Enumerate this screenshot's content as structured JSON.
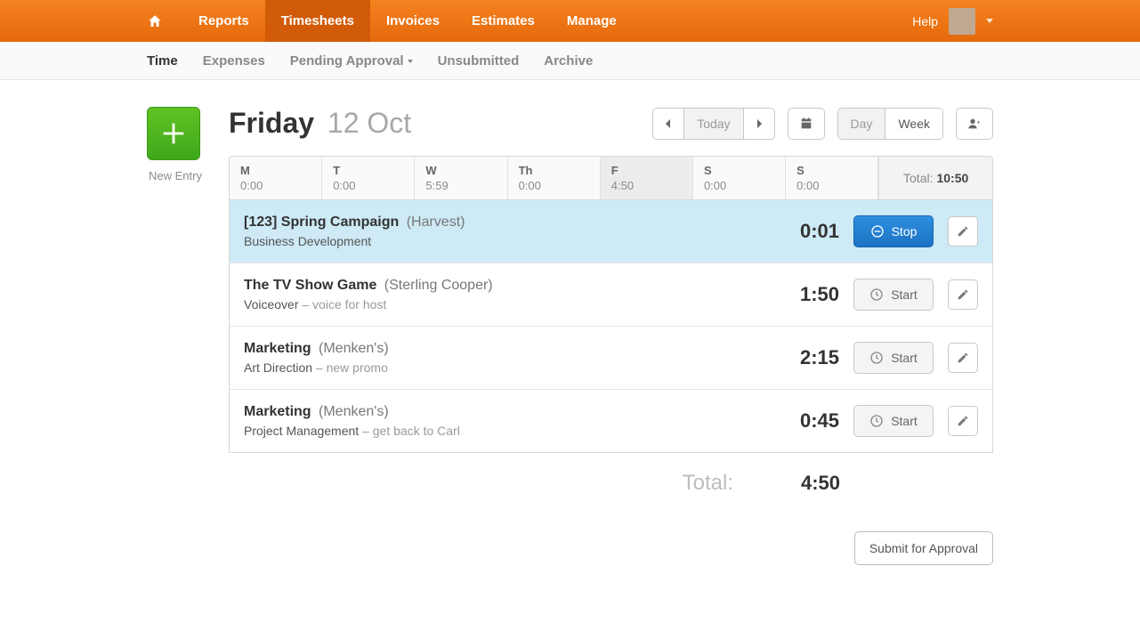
{
  "topnav": {
    "items": [
      {
        "label": "Reports"
      },
      {
        "label": "Timesheets",
        "active": true
      },
      {
        "label": "Invoices"
      },
      {
        "label": "Estimates"
      },
      {
        "label": "Manage"
      }
    ],
    "help_label": "Help"
  },
  "subnav": {
    "items": [
      {
        "label": "Time",
        "active": true
      },
      {
        "label": "Expenses"
      },
      {
        "label": "Pending Approval",
        "has_dropdown": true
      },
      {
        "label": "Unsubmitted"
      },
      {
        "label": "Archive"
      }
    ]
  },
  "date": {
    "day_name": "Friday",
    "day_sub": "12 Oct"
  },
  "controls": {
    "today_label": "Today",
    "day_label": "Day",
    "week_label": "Week"
  },
  "new_entry_label": "New Entry",
  "week": {
    "days": [
      {
        "abbrev": "M",
        "hours": "0:00"
      },
      {
        "abbrev": "T",
        "hours": "0:00"
      },
      {
        "abbrev": "W",
        "hours": "5:59"
      },
      {
        "abbrev": "Th",
        "hours": "0:00"
      },
      {
        "abbrev": "F",
        "hours": "4:50",
        "active": true
      },
      {
        "abbrev": "S",
        "hours": "0:00"
      },
      {
        "abbrev": "S",
        "hours": "0:00"
      }
    ],
    "total_label": "Total:",
    "total_value": "10:50"
  },
  "entries": [
    {
      "project": "[123] Spring Campaign",
      "client": "(Harvest)",
      "task": "Business Development",
      "note": "",
      "time": "0:01",
      "running": true,
      "action_label": "Stop"
    },
    {
      "project": "The TV Show Game",
      "client": "(Sterling Cooper)",
      "task": "Voiceover",
      "note": "voice for host",
      "time": "1:50",
      "running": false,
      "action_label": "Start"
    },
    {
      "project": "Marketing",
      "client": "(Menken's)",
      "task": "Art Direction",
      "note": "new promo",
      "time": "2:15",
      "running": false,
      "action_label": "Start"
    },
    {
      "project": "Marketing",
      "client": "(Menken's)",
      "task": "Project Management",
      "note": "get back to Carl",
      "time": "0:45",
      "running": false,
      "action_label": "Start"
    }
  ],
  "day_total": {
    "label": "Total:",
    "value": "4:50"
  },
  "submit_label": "Submit for Approval"
}
